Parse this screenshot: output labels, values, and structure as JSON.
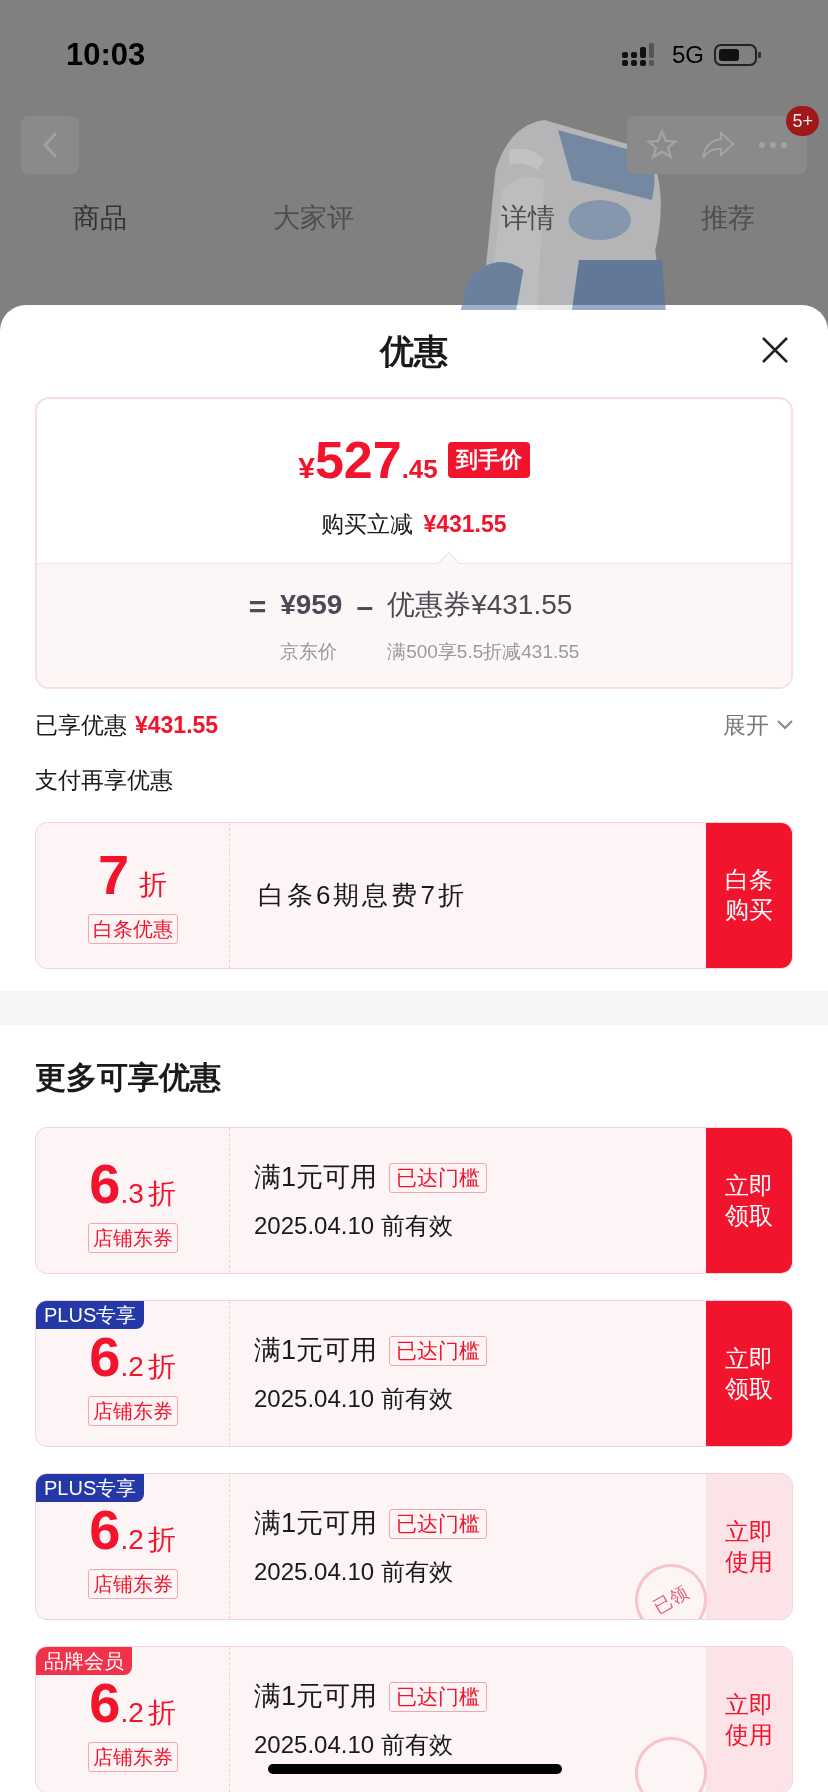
{
  "status_bar": {
    "time": "10:03",
    "network": "5G"
  },
  "background": {
    "badge": "5+",
    "tabs": [
      {
        "label": "商品",
        "selected": true
      },
      {
        "label": "大家评",
        "selected": false
      },
      {
        "label": "详情",
        "selected": false
      },
      {
        "label": "推荐",
        "selected": false
      }
    ]
  },
  "sheet": {
    "title": "优惠"
  },
  "price_card": {
    "currency": "¥",
    "integer": "527",
    "decimal": ".45",
    "tag": "到手价",
    "saving_label": "购买立减",
    "saving_amount": "¥431.55",
    "equals": "=",
    "list_price": "¥959",
    "minus": "–",
    "coupon": "优惠券¥431.55",
    "list_price_caption": "京东价",
    "coupon_caption": "满500享5.5折减431.55"
  },
  "enjoyed": {
    "label": "已享优惠",
    "amount": "¥431.55",
    "toggle": "展开"
  },
  "pay_section": {
    "title": "支付再享优惠",
    "offer": {
      "discount": "7",
      "unit": "折",
      "type": "白条优惠",
      "text": "白条6期息费7折",
      "button": "白条购买"
    }
  },
  "more_section": {
    "title": "更多可享优惠"
  },
  "coupons": [
    {
      "discount": "6",
      "decimal": ".3",
      "unit": "折",
      "type": "店铺东券",
      "condition": "满1元可用",
      "threshold": "已达门槛",
      "validity": "2025.04.10 前有效",
      "button": "立即领取",
      "claimed": false
    },
    {
      "label": "PLUS专享",
      "color": "#2438a8",
      "discount": "6",
      "decimal": ".2",
      "unit": "折",
      "type": "店铺东券",
      "condition": "满1元可用",
      "threshold": "已达门槛",
      "validity": "2025.04.10 前有效",
      "button": "立即领取",
      "claimed": false
    },
    {
      "label": "PLUS专享",
      "color": "#2438a8",
      "discount": "6",
      "decimal": ".2",
      "unit": "折",
      "type": "店铺东券",
      "condition": "满1元可用",
      "threshold": "已达门槛",
      "validity": "2025.04.10 前有效",
      "button": "立即使用",
      "claimed": true,
      "stamp": "已领"
    },
    {
      "label": "品牌会员",
      "color": "#f0334a",
      "discount": "6",
      "decimal": ".2",
      "unit": "折",
      "type": "店铺东券",
      "condition": "满1元可用",
      "threshold": "已达门槛",
      "validity": "2025.04.10 前有效",
      "button": "立即使用",
      "claimed": true
    }
  ]
}
